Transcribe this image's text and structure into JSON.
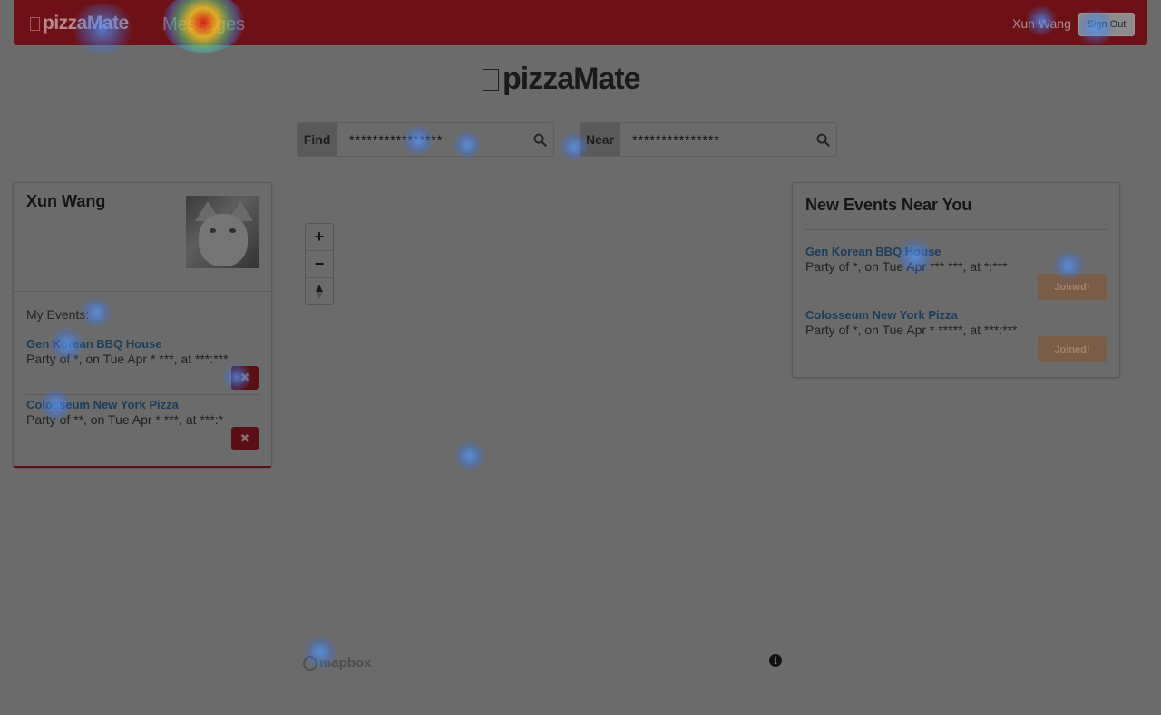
{
  "navbar": {
    "brand": "pizzaMate",
    "messages_link": "Messages",
    "user_name": "Xun Wang",
    "signout_label": "Sign Out"
  },
  "logo": {
    "text": "pizzaMate"
  },
  "search": {
    "find_label": "Find",
    "find_value": "****************",
    "near_label": "Near",
    "near_value": "***************"
  },
  "profile": {
    "name": "Xun Wang",
    "my_events_label": "My Events:",
    "events": [
      {
        "title": "Gen Korean BBQ House",
        "desc": "Party of *, on Tue Apr * ***, at ***:***",
        "delete_icon": "times-icon"
      },
      {
        "title": "Colosseum New York Pizza",
        "desc": "Party of **, on Tue Apr * ***, at ***:*",
        "delete_icon": "times-icon"
      }
    ]
  },
  "new_events": {
    "heading": "New Events Near You",
    "events": [
      {
        "title": "Gen Korean BBQ House",
        "desc": "Party of *, on Tue Apr *** ***, at *:***",
        "button": "Joined!"
      },
      {
        "title": "Colosseum New York Pizza",
        "desc": "Party of *, on Tue Apr * *****, at ***:***",
        "button": "Joined!"
      }
    ]
  },
  "map": {
    "zoom_in": "+",
    "zoom_out": "−",
    "compass_icon": "compass-icon",
    "attribution": "mapbox",
    "info": "i"
  },
  "colors": {
    "brand_red": "#c41e26",
    "link_blue": "#2a6db0",
    "joined_orange": "#f0a372"
  }
}
